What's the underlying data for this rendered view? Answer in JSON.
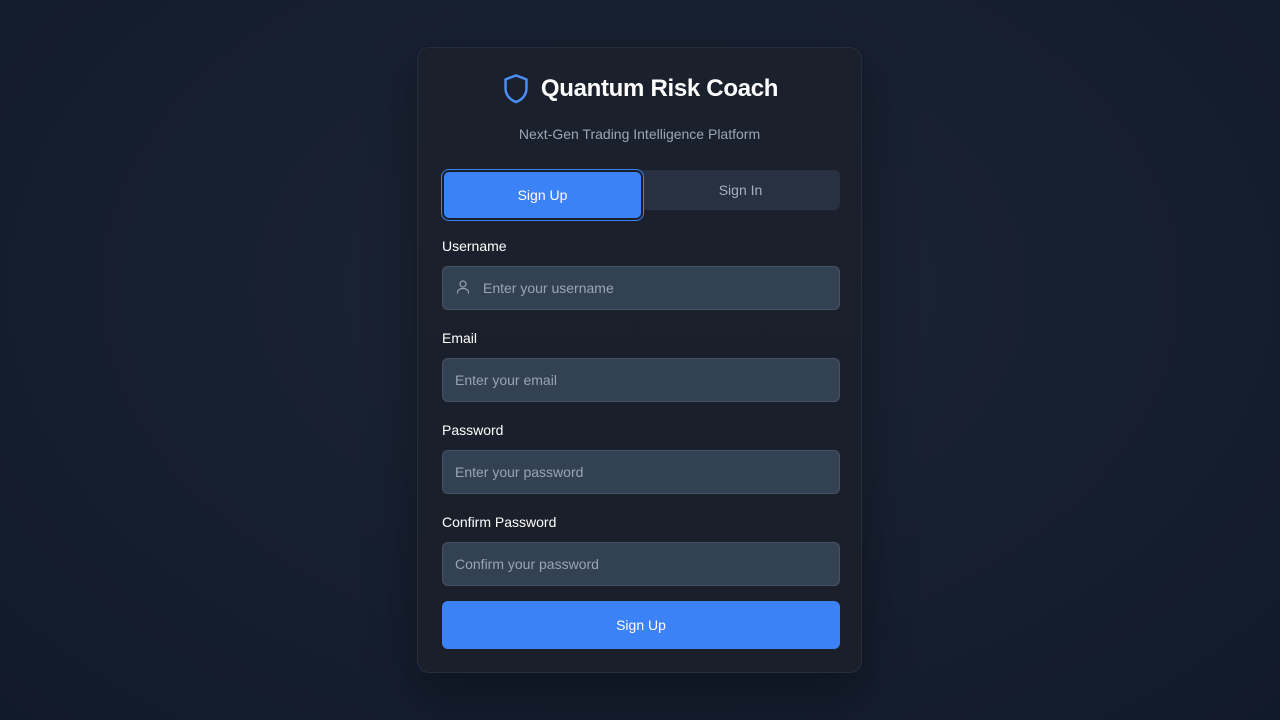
{
  "brand": {
    "icon": "shield-icon",
    "title": "Quantum Risk Coach",
    "subtitle": "Next-Gen Trading Intelligence Platform",
    "accent_color": "#3b82f6"
  },
  "tabs": [
    {
      "label": "Sign Up",
      "active": true
    },
    {
      "label": "Sign In",
      "active": false
    }
  ],
  "form": {
    "username": {
      "label": "Username",
      "placeholder": "Enter your username",
      "value": "",
      "icon": "user-icon"
    },
    "email": {
      "label": "Email",
      "placeholder": "Enter your email",
      "value": ""
    },
    "password": {
      "label": "Password",
      "placeholder": "Enter your password",
      "value": ""
    },
    "confirm_password": {
      "label": "Confirm Password",
      "placeholder": "Confirm your password",
      "value": ""
    },
    "submit_label": "Sign Up"
  }
}
